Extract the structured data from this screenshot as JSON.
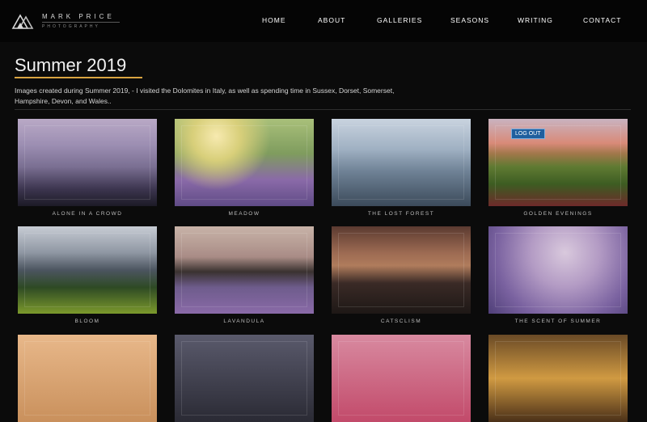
{
  "brand": {
    "name": "MARK PRICE",
    "tagline": "PHOTOGRAPHY"
  },
  "nav": {
    "items": [
      {
        "label": "HOME"
      },
      {
        "label": "ABOUT"
      },
      {
        "label": "GALLERIES"
      },
      {
        "label": "SEASONS"
      },
      {
        "label": "WRITING"
      },
      {
        "label": "CONTACT"
      }
    ]
  },
  "page": {
    "title": "Summer 2019",
    "description": "Images created during Summer 2019, - I visited the Dolomites in Italy, as well as spending time in Sussex, Dorset, Somerset, Hampshire, Devon, and Wales..",
    "accent_color": "#d9a441"
  },
  "admin": {
    "logout_label": "LOG OUT"
  },
  "gallery": {
    "items": [
      {
        "caption": "ALONE IN A CROWD"
      },
      {
        "caption": "MEADOW"
      },
      {
        "caption": "THE LOST FOREST"
      },
      {
        "caption": "GOLDEN EVENINGS"
      },
      {
        "caption": "BLOOM"
      },
      {
        "caption": "LAVANDULA"
      },
      {
        "caption": "CATSCLISM"
      },
      {
        "caption": "THE SCENT OF SUMMER"
      },
      {
        "caption": ""
      },
      {
        "caption": ""
      },
      {
        "caption": ""
      },
      {
        "caption": ""
      }
    ]
  }
}
